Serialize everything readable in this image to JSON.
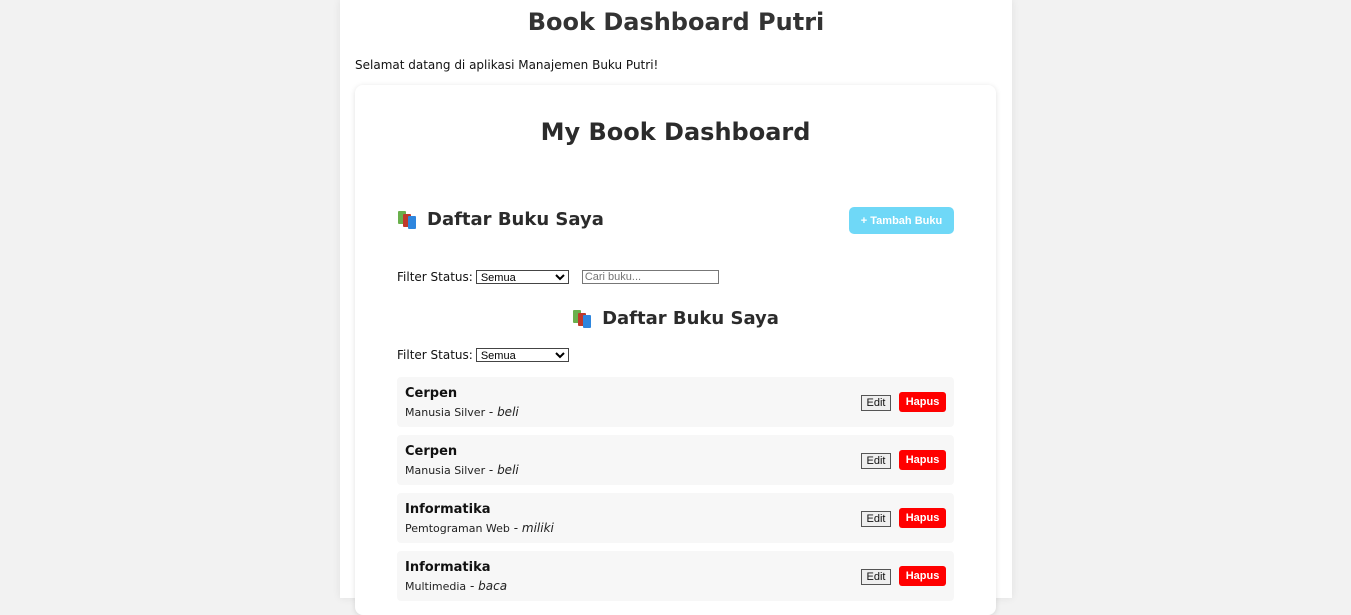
{
  "header": {
    "app_title": "Book Dashboard Putri",
    "welcome_text": "Selamat datang di aplikasi Manajemen Buku Putri!"
  },
  "card": {
    "title": "My Book Dashboard",
    "section_title": "Daftar Buku Saya",
    "section_icon": "books-icon",
    "add_button_label": "+ Tambah Buku",
    "filter_label": "Filter Status:",
    "filter_selected": "Semua",
    "search_placeholder": "Cari buku...",
    "section_title_2": "Daftar Buku Saya",
    "filter_label_2": "Filter Status:",
    "filter_selected_2": "Semua"
  },
  "books": [
    {
      "title": "Cerpen",
      "subtitle": "Manusia Silver",
      "status": "beli",
      "edit_label": "Edit",
      "delete_label": "Hapus"
    },
    {
      "title": "Cerpen",
      "subtitle": "Manusia Silver",
      "status": "beli",
      "edit_label": "Edit",
      "delete_label": "Hapus"
    },
    {
      "title": "Informatika",
      "subtitle": "Pemtograman Web",
      "status": "miliki",
      "edit_label": "Edit",
      "delete_label": "Hapus"
    },
    {
      "title": "Informatika",
      "subtitle": "Multimedia",
      "status": "baca",
      "edit_label": "Edit",
      "delete_label": "Hapus"
    }
  ],
  "colors": {
    "add_button": "#6fd8f7",
    "delete_button": "#ff0000",
    "item_background": "#f7f7f7"
  }
}
